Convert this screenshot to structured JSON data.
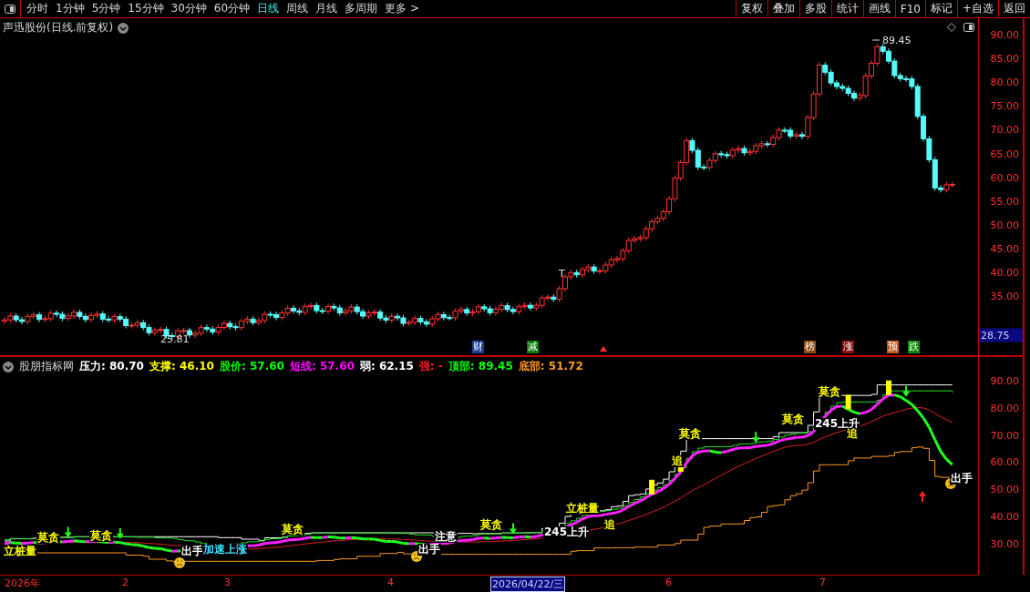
{
  "toolbar": {
    "periods": [
      {
        "label": "分时",
        "selected": false
      },
      {
        "label": "1分钟",
        "selected": false
      },
      {
        "label": "5分钟",
        "selected": false
      },
      {
        "label": "15分钟",
        "selected": false
      },
      {
        "label": "30分钟",
        "selected": false
      },
      {
        "label": "60分钟",
        "selected": false
      },
      {
        "label": "日线",
        "selected": true
      },
      {
        "label": "周线",
        "selected": false
      },
      {
        "label": "月线",
        "selected": false
      },
      {
        "label": "多周期",
        "selected": false
      },
      {
        "label": "更多 >",
        "selected": false
      }
    ],
    "buttons": [
      "复权",
      "叠加",
      "多股",
      "统计",
      "画线",
      "F10",
      "标记",
      "+自选",
      "返回"
    ]
  },
  "price_chart": {
    "title": "声迅股份(日线.前复权)",
    "axis": [
      "90.00",
      "85.00",
      "80.00",
      "75.00",
      "70.00",
      "65.00",
      "60.00",
      "55.00",
      "50.00",
      "45.00",
      "40.00",
      "35.00"
    ],
    "current": "28.75",
    "high": "89.45",
    "low": "25.81",
    "mark": "T",
    "events": [
      {
        "text": "财",
        "color": "#1e3f96"
      },
      {
        "text": "减",
        "color": "#0a7a0a"
      },
      {
        "text": "榜",
        "color": "#8a4a12"
      },
      {
        "text": "涨",
        "color": "#8b0a0a"
      },
      {
        "text": "预",
        "color": "#c8561a"
      },
      {
        "text": "跌",
        "color": "#0a8a0a"
      }
    ]
  },
  "indicator": {
    "title": "股朋指标网",
    "legend": [
      {
        "label": "压力:",
        "value": "80.70",
        "color": "#ffffff"
      },
      {
        "label": "支撑:",
        "value": "46.10",
        "color": "#ffff00"
      },
      {
        "label": "股价:",
        "value": "57.60",
        "color": "#00ff00"
      },
      {
        "label": "短线:",
        "value": "57.60",
        "color": "#ff00ff"
      },
      {
        "label": "弱:",
        "value": "62.15",
        "color": "#ffffff"
      },
      {
        "label": "强:",
        "value": "-",
        "color": "#ff2020"
      },
      {
        "label": "顶部:",
        "value": "89.45",
        "color": "#00ff00"
      },
      {
        "label": "底部:",
        "value": "51.72",
        "color": "#ff9a20"
      }
    ],
    "axis": [
      "90.00",
      "80.00",
      "70.00",
      "60.00",
      "50.00",
      "40.00",
      "30.00"
    ],
    "signals": [
      {
        "text": "立桩量",
        "color": "#ffff00"
      },
      {
        "text": "莫贪",
        "color": "#ffff00"
      },
      {
        "text": "莫贪",
        "color": "#ffff00"
      },
      {
        "text": "出手",
        "color": "#ffffff"
      },
      {
        "text": "加速上涨",
        "color": "#40e0ff"
      },
      {
        "text": "莫贪",
        "color": "#ffff00"
      },
      {
        "text": "出手",
        "color": "#ffffff"
      },
      {
        "text": "注意",
        "color": "#ffffff"
      },
      {
        "text": "莫贪",
        "color": "#ffff00"
      },
      {
        "text": "245上升",
        "color": "#ffffff"
      },
      {
        "text": "立桩量",
        "color": "#ffff00"
      },
      {
        "text": "追",
        "color": "#ffff00"
      },
      {
        "text": "追",
        "color": "#ffff00"
      },
      {
        "text": "莫贪",
        "color": "#ffff00"
      },
      {
        "text": "莫贪",
        "color": "#ffff00"
      },
      {
        "text": "245上升",
        "color": "#ffffff"
      },
      {
        "text": "追",
        "color": "#ffff00"
      },
      {
        "text": "莫贪",
        "color": "#ffff00"
      },
      {
        "text": "出手",
        "color": "#ffffff"
      }
    ]
  },
  "date_axis": [
    {
      "label": "2026年",
      "selected": false
    },
    {
      "label": "2",
      "selected": false
    },
    {
      "label": "3",
      "selected": false
    },
    {
      "label": "4",
      "selected": false
    },
    {
      "label": "2026/04/22/三",
      "selected": true
    },
    {
      "label": "6",
      "selected": false
    },
    {
      "label": "7",
      "selected": false
    }
  ]
}
